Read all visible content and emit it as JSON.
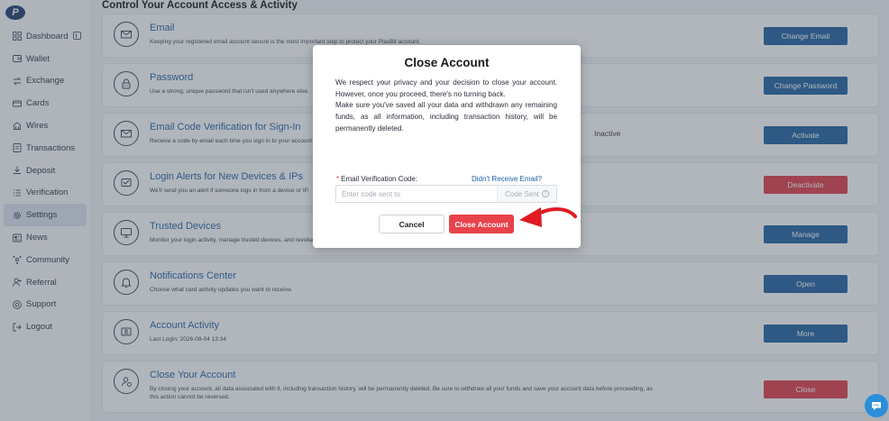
{
  "sidebar": {
    "logo": "P",
    "items": [
      {
        "label": "Dashboard",
        "icon": "grid-icon"
      },
      {
        "label": "Wallet",
        "icon": "wallet-icon"
      },
      {
        "label": "Exchange",
        "icon": "exchange-icon"
      },
      {
        "label": "Cards",
        "icon": "card-icon"
      },
      {
        "label": "Wires",
        "icon": "wires-icon"
      },
      {
        "label": "Transactions",
        "icon": "transactions-icon"
      },
      {
        "label": "Deposit",
        "icon": "deposit-icon"
      },
      {
        "label": "Verification",
        "icon": "verification-icon"
      },
      {
        "label": "Settings",
        "icon": "gear-icon",
        "active": true
      },
      {
        "label": "News",
        "icon": "news-icon"
      },
      {
        "label": "Community",
        "icon": "community-icon"
      },
      {
        "label": "Referral",
        "icon": "referral-icon"
      },
      {
        "label": "Support",
        "icon": "support-icon"
      },
      {
        "label": "Logout",
        "icon": "logout-icon"
      }
    ]
  },
  "page": {
    "title": "Control Your Account Access & Activity"
  },
  "cards": [
    {
      "title": "Email",
      "desc": "Keeping your registered email account secure is the most important step to protect your PlasBit account.",
      "button": "Change Email",
      "button_color": "blue",
      "icon": "email-icon"
    },
    {
      "title": "Password",
      "desc": "Use a strong, unique password that isn't used anywhere else.",
      "button": "Change Password",
      "button_color": "blue",
      "icon": "lock-icon"
    },
    {
      "title": "Email Code Verification for Sign-In",
      "desc": "Receive a code by email each time you sign in to your account.",
      "status": "Inactive",
      "button": "Activate",
      "button_color": "blue",
      "icon": "email-verify-icon"
    },
    {
      "title": "Login Alerts for New Devices & IPs",
      "desc": "We'll send you an alert if someone logs in from a device or IP.",
      "button": "Deactivate",
      "button_color": "red",
      "icon": "alert-icon"
    },
    {
      "title": "Trusted Devices",
      "desc": "Monitor your login activity, manage trusted devices, and revoke access.",
      "button": "Manage",
      "button_color": "blue",
      "icon": "monitor-icon"
    },
    {
      "title": "Notifications Center",
      "desc": "Choose what card activity updates you want to receive.",
      "button": "Open",
      "button_color": "blue",
      "icon": "bell-icon"
    },
    {
      "title": "Account Activity",
      "desc": "Last Login: 2026-08-04 13:34",
      "button": "More",
      "button_color": "blue",
      "icon": "activity-icon"
    },
    {
      "title": "Close Your Account",
      "desc": "By closing your account, all data associated with it, including transaction history, will be permanently deleted. Be sure to withdraw all your funds and save your account data before proceeding, as this action cannot be reversed.",
      "button": "Close",
      "button_color": "red",
      "icon": "user-close-icon"
    }
  ],
  "modal": {
    "title": "Close Account",
    "paragraph1": "We respect your privacy and your decision to close your account. However, once you proceed, there's no turning back.",
    "paragraph2": "Make sure you've saved all your data and withdrawn any remaining funds, as all information, including transaction history, will be permanently deleted.",
    "field_label": "Email Verification Code:",
    "field_required": "*",
    "resend_link": "Didn't Receive Email?",
    "input_placeholder": "Enter code sent to",
    "input_value": "",
    "code_sent_label": "Code Sent",
    "cancel_label": "Cancel",
    "close_label": "Close Account"
  },
  "colors": {
    "primary_blue": "#1d5f9f",
    "danger_red": "#e23a45",
    "link_blue": "#1f5fa6",
    "annotation_arrow": "#e01b22"
  }
}
